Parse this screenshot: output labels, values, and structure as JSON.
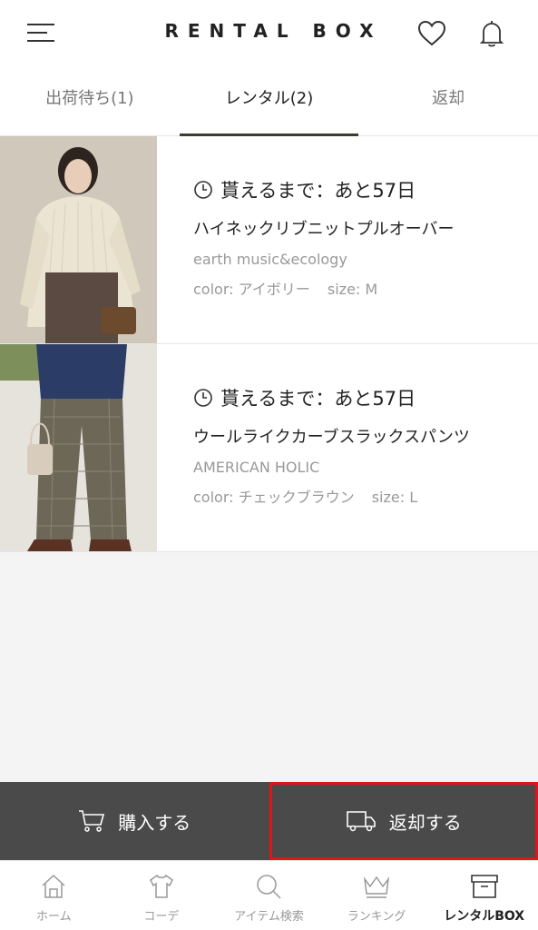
{
  "header": {
    "logo": "RENTAL BOX"
  },
  "tabs": [
    {
      "label": "出荷待ち(1)",
      "active": false
    },
    {
      "label": "レンタル(2)",
      "active": true
    },
    {
      "label": "返却",
      "active": false
    }
  ],
  "items": [
    {
      "countdown": "貰えるまで：あと57日",
      "name": "ハイネックリブニットプルオーバー",
      "brand": "earth music&ecology",
      "color": "color: アイボリー",
      "size": "size: M"
    },
    {
      "countdown": "貰えるまで：あと57日",
      "name": "ウールライクカーブスラックスパンツ",
      "brand": "AMERICAN HOLIC",
      "color": "color: チェックブラウン",
      "size": "size: L"
    }
  ],
  "actions": {
    "purchase": "購入する",
    "return": "返却する"
  },
  "bottom_nav": [
    {
      "label": "ホーム",
      "icon": "home-icon"
    },
    {
      "label": "コーデ",
      "icon": "tshirt-icon"
    },
    {
      "label": "アイテム検索",
      "icon": "search-icon"
    },
    {
      "label": "ランキング",
      "icon": "crown-icon"
    },
    {
      "label": "レンタルBOX",
      "icon": "box-icon",
      "active": true
    }
  ],
  "colors": {
    "active_tab_underline": "#3c3c2c",
    "action_bar": "#4a4a4a",
    "highlight": "#e0141c"
  }
}
